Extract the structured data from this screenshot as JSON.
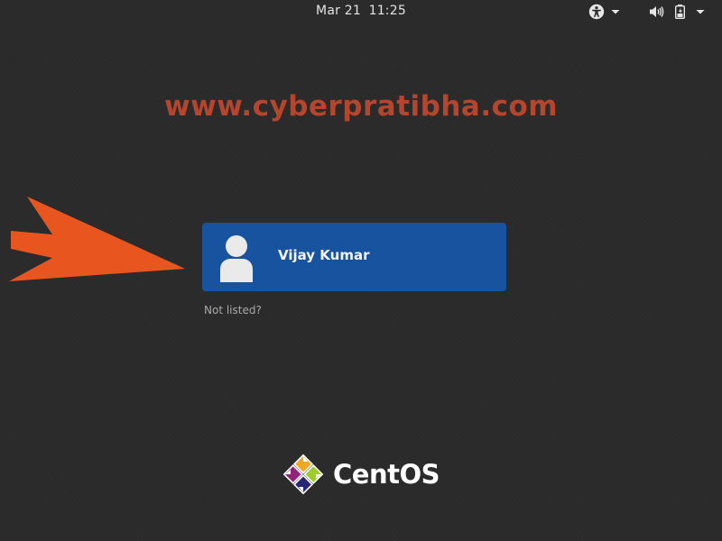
{
  "topbar": {
    "date": "Mar 21",
    "time": "11:25",
    "accessibility_icon": "accessibility-icon",
    "volume_icon": "volume-icon",
    "battery_icon": "battery-icon",
    "menu_icon": "chevron-down-icon"
  },
  "watermark": {
    "text": "www.cyberpratibha.com",
    "color": "#b5452d"
  },
  "annotation": {
    "arrow_icon": "arrow-right-icon",
    "arrow_color": "#e8551f"
  },
  "user_list": {
    "users": [
      {
        "name": "Vijay Kumar",
        "avatar_icon": "user-avatar-icon"
      }
    ],
    "not_listed_label": "Not listed?"
  },
  "branding": {
    "logo_text": "CentOS",
    "logo_icon": "centos-logo-icon"
  },
  "colors": {
    "background": "#2b2b2b",
    "selected_tile": "#17539f",
    "text": "#eeeeec"
  }
}
